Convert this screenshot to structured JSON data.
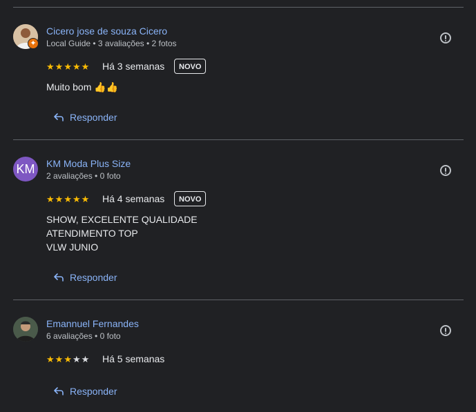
{
  "reviews": [
    {
      "name": "Cicero jose de souza Cicero",
      "meta": "Local Guide • 3 avaliações • 2 fotos",
      "rating": 5,
      "time": "Há 3 semanas",
      "badge": "NOVO",
      "text_lines": [
        "Muito bom 👍👍"
      ],
      "reply_label": "Responder",
      "avatar_icon": "user-photo-icon",
      "local_guide_badge_icon": "local-guide-badge-icon"
    },
    {
      "name": "KM Moda Plus Size",
      "meta": "2 avaliações • 0 foto",
      "rating": 5,
      "time": "Há 4 semanas",
      "badge": "NOVO",
      "text_lines": [
        "SHOW, EXCELENTE QUALIDADE",
        "ATENDIMENTO TOP",
        "VLW JUNIO"
      ],
      "reply_label": "Responder",
      "avatar_initials": "KM",
      "avatar_color": "#7e57c2"
    },
    {
      "name": "Emannuel Fernandes",
      "meta": "6 avaliações • 0 foto",
      "rating": 3,
      "time": "Há 5 semanas",
      "text_lines": [],
      "reply_label": "Responder",
      "avatar_icon": "user-photo-icon"
    }
  ],
  "colors": {
    "background": "#202124",
    "link": "#8ab4f8",
    "star_on": "#fbbc04",
    "star_off": "#dadce0",
    "divider": "#5f6368"
  }
}
